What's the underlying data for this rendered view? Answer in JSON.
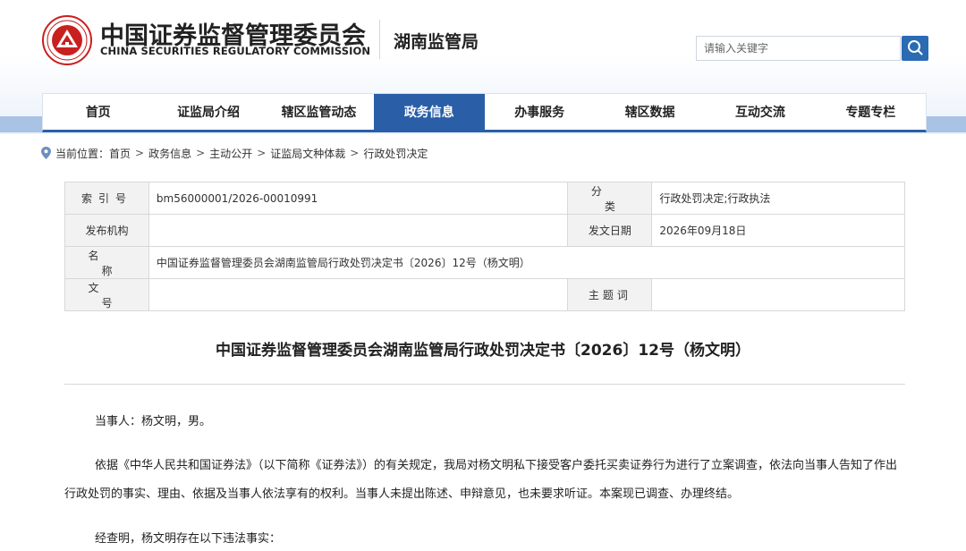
{
  "header": {
    "logo_cn": "中国证券监督管理委员会",
    "logo_en": "CHINA SECURITIES REGULATORY COMMISSION",
    "bureau_name": "湖南监管局"
  },
  "search": {
    "placeholder": "请输入关键字"
  },
  "nav": {
    "items": [
      {
        "label": "首页"
      },
      {
        "label": "证监局介绍"
      },
      {
        "label": "辖区监管动态"
      },
      {
        "label": "政务信息"
      },
      {
        "label": "办事服务"
      },
      {
        "label": "辖区数据"
      },
      {
        "label": "互动交流"
      },
      {
        "label": "专题专栏"
      }
    ],
    "active_index": 3
  },
  "breadcrumb": {
    "prefix": "当前位置：",
    "items": [
      "首页",
      "政务信息",
      "主动公开",
      "证监局文种体裁",
      "行政处罚决定"
    ],
    "separator": ">"
  },
  "info_table": {
    "index_label": "索引号",
    "index_value": "bm56000001/2026-00010991",
    "category_label": "分类",
    "category_value": "行政处罚决定;行政执法",
    "publisher_label": "发布机构",
    "publisher_value": "",
    "date_label": "发文日期",
    "date_value": "2026年09月18日",
    "name_label": "名称",
    "name_value": "中国证券监督管理委员会湖南监管局行政处罚决定书〔2026〕12号（杨文明）",
    "doc_no_label": "文号",
    "doc_no_value": "",
    "keywords_label": "主题词",
    "keywords_value": ""
  },
  "document": {
    "title": "中国证券监督管理委员会湖南监管局行政处罚决定书〔2026〕12号（杨文明）",
    "paragraphs": [
      "当事人：杨文明，男。",
      "依据《中华人民共和国证券法》（以下简称《证券法》）的有关规定，我局对杨文明私下接受客户委托买卖证券行为进行了立案调查，依法向当事人告知了作出行政处罚的事实、理由、依据及当事人依法享有的权利。当事人未提出陈述、申辩意见，也未要求听证。本案现已调查、办理终结。",
      "经查明，杨文明存在以下违法事实："
    ]
  },
  "colors": {
    "nav_active": "#2a5fa8",
    "search_button": "#2a6bb4",
    "logo_red": "#c8201f"
  }
}
